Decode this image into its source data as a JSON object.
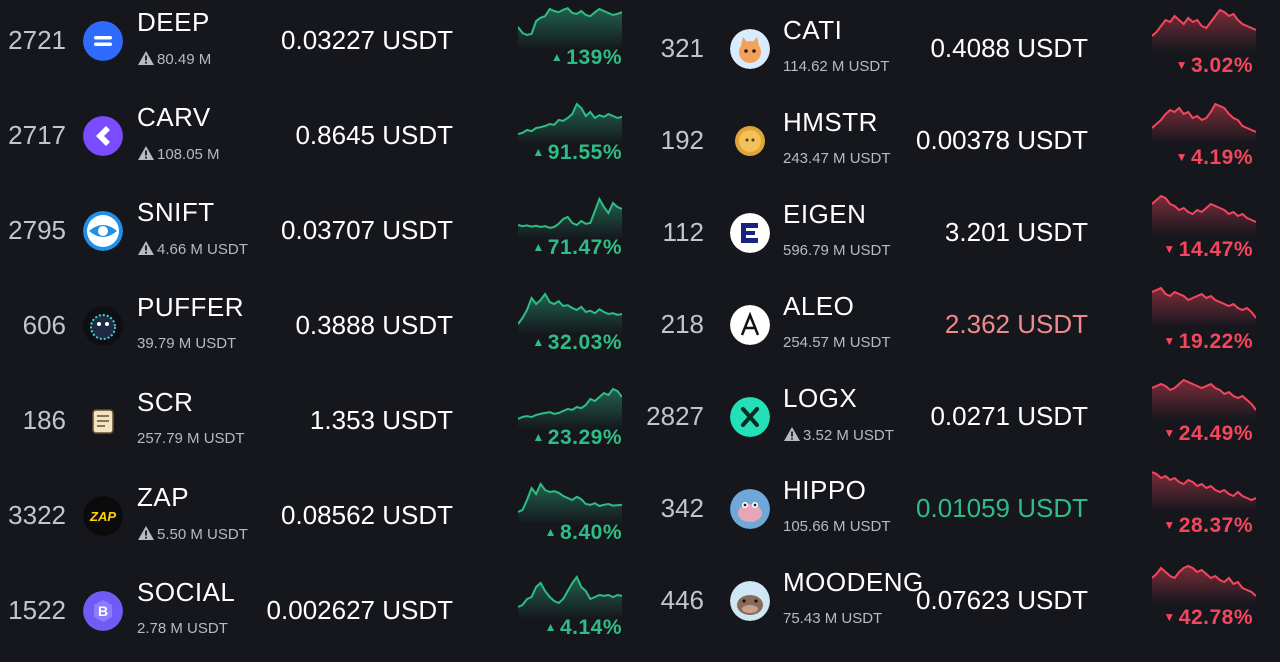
{
  "colors": {
    "up": "#2ebd85",
    "down": "#f6465d",
    "price_down": "#f08a8f",
    "price_up": "#2ebd85"
  },
  "left": [
    {
      "rank": "2721",
      "name": "DEEP",
      "volume": "80.49 M",
      "warning": true,
      "price": "0.03227 USDT",
      "change": "139%",
      "direction": "up",
      "icon": "deep-icon"
    },
    {
      "rank": "2717",
      "name": "CARV",
      "volume": "108.05 M",
      "warning": true,
      "price": "0.8645 USDT",
      "change": "91.55%",
      "direction": "up",
      "icon": "carv-icon"
    },
    {
      "rank": "2795",
      "name": "SNIFT",
      "volume": "4.66 M USDT",
      "warning": true,
      "price": "0.03707 USDT",
      "change": "71.47%",
      "direction": "up",
      "icon": "snift-icon"
    },
    {
      "rank": "606",
      "name": "PUFFER",
      "volume": "39.79 M USDT",
      "warning": false,
      "price": "0.3888 USDT",
      "change": "32.03%",
      "direction": "up",
      "icon": "puffer-icon"
    },
    {
      "rank": "186",
      "name": "SCR",
      "volume": "257.79 M USDT",
      "warning": false,
      "price": "1.353 USDT",
      "change": "23.29%",
      "direction": "up",
      "icon": "scroll-icon"
    },
    {
      "rank": "3322",
      "name": "ZAP",
      "volume": "5.50 M USDT",
      "warning": true,
      "price": "0.08562 USDT",
      "change": "8.40%",
      "direction": "up",
      "icon": "zap-icon"
    },
    {
      "rank": "1522",
      "name": "SOCIAL",
      "volume": "2.78 M USDT",
      "warning": false,
      "price": "0.002627 USDT",
      "change": "4.14%",
      "direction": "up",
      "icon": "social-icon"
    }
  ],
  "right": [
    {
      "rank": "321",
      "name": "CATI",
      "volume": "114.62 M USDT",
      "warning": false,
      "price": "0.4088 USDT",
      "change": "3.02%",
      "direction": "down",
      "icon": "cati-icon"
    },
    {
      "rank": "192",
      "name": "HMSTR",
      "volume": "243.47 M USDT",
      "warning": false,
      "price": "0.00378 USDT",
      "change": "4.19%",
      "direction": "down",
      "icon": "hmstr-icon"
    },
    {
      "rank": "112",
      "name": "EIGEN",
      "volume": "596.79 M USDT",
      "warning": false,
      "price": "3.201 USDT",
      "change": "14.47%",
      "direction": "down",
      "icon": "eigen-icon"
    },
    {
      "rank": "218",
      "name": "ALEO",
      "volume": "254.57 M USDT",
      "warning": false,
      "price": "2.362 USDT",
      "change": "19.22%",
      "direction": "down",
      "icon": "aleo-icon",
      "price_color": "price_down"
    },
    {
      "rank": "2827",
      "name": "LOGX",
      "volume": "3.52 M USDT",
      "warning": true,
      "price": "0.0271 USDT",
      "change": "24.49%",
      "direction": "down",
      "icon": "logx-icon"
    },
    {
      "rank": "342",
      "name": "HIPPO",
      "volume": "105.66 M USDT",
      "warning": false,
      "price": "0.01059 USDT",
      "change": "28.37%",
      "direction": "down",
      "icon": "hippo-icon",
      "price_color": "price_up"
    },
    {
      "rank": "446",
      "name": "MOODENG",
      "volume": "75.43 M USDT",
      "warning": false,
      "price": "0.07623 USDT",
      "change": "42.78%",
      "direction": "down",
      "icon": "moodeng-icon"
    }
  ]
}
